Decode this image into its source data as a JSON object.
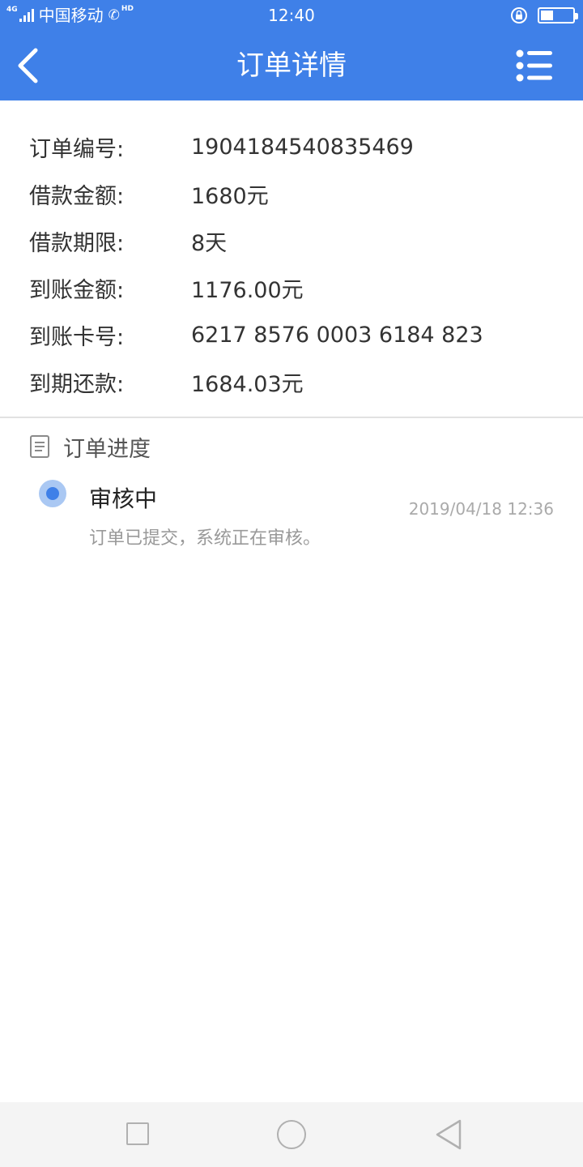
{
  "status_bar": {
    "network": "4G",
    "carrier": "中国移动",
    "hd": "HD",
    "call_icon": "phone-icon",
    "time": "12:40",
    "battery_level": 0.4
  },
  "header": {
    "title": "订单详情",
    "back_icon": "chevron-left-icon",
    "menu_icon": "list-menu-icon",
    "color": "#3f80e8"
  },
  "details": [
    {
      "label": "订单编号:",
      "value": "1904184540835469"
    },
    {
      "label": "借款金额:",
      "value": "1680元"
    },
    {
      "label": "借款期限:",
      "value": "8天"
    },
    {
      "label": "到账金额:",
      "value": "1176.00元"
    },
    {
      "label": "到账卡号:",
      "value": "6217 8576 0003 6184 823"
    },
    {
      "label": "到期还款:",
      "value": "1684.03元"
    }
  ],
  "progress": {
    "section_title": "订单进度",
    "icon": "document-icon",
    "items": [
      {
        "status": "审核中",
        "time": "2019/04/18 12:36",
        "description": "订单已提交，系统正在审核。"
      }
    ]
  },
  "nav_bar": {
    "buttons": [
      "recent-apps-icon",
      "home-icon",
      "back-icon"
    ]
  }
}
